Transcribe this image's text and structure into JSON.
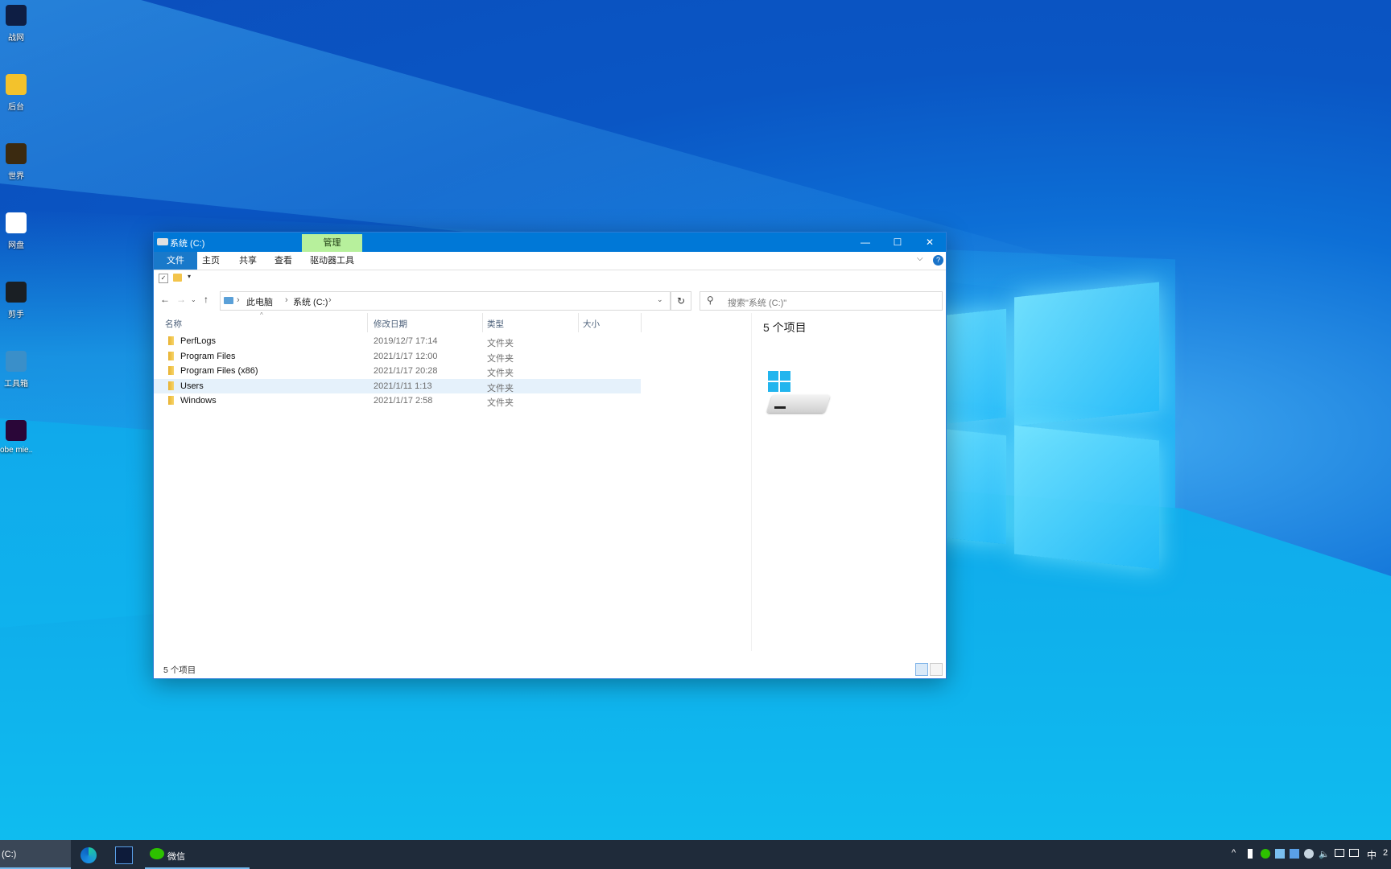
{
  "desktop": {
    "icons": [
      {
        "label": "战网",
        "color": "#0e1e44"
      },
      {
        "label": "后台",
        "color": "#f3c22c"
      },
      {
        "label": "世界",
        "color": "#3b2a10"
      },
      {
        "label": "网盘",
        "color": "#ffffff"
      },
      {
        "label": "剪手",
        "color": "#1a1f24"
      },
      {
        "label": "工具箱",
        "color": "#3a8fc9"
      },
      {
        "label": "obe\nmie...",
        "color": "#2a0638"
      }
    ]
  },
  "window": {
    "title": "系统 (C:)",
    "manage_tab": "管理",
    "controls": {
      "minimize": "—",
      "maximize": "☐",
      "close": "✕"
    }
  },
  "ribbon": {
    "tabs": [
      "文件",
      "主页",
      "共享",
      "查看",
      "驱动器工具"
    ],
    "expand": "⌵",
    "help": "?"
  },
  "qat": {
    "check": "✓",
    "dropdown": "▾"
  },
  "nav": {
    "back": "←",
    "forward": "→",
    "recent": "⌄",
    "up": "↑",
    "breadcrumb": [
      "此电脑",
      "系统 (C:)"
    ],
    "separator": "›",
    "dropdown": "⌄",
    "refresh": "↻"
  },
  "search": {
    "icon": "⚲",
    "placeholder": "搜索\"系统 (C:)\""
  },
  "columns": {
    "name": "名称",
    "date": "修改日期",
    "type": "类型",
    "size": "大小",
    "sort_caret": "^"
  },
  "files": [
    {
      "name": "PerfLogs",
      "date": "2019/12/7 17:14",
      "type": "文件夹"
    },
    {
      "name": "Program Files",
      "date": "2021/1/17 12:00",
      "type": "文件夹"
    },
    {
      "name": "Program Files (x86)",
      "date": "2021/1/17 20:28",
      "type": "文件夹"
    },
    {
      "name": "Users",
      "date": "2021/1/11 1:13",
      "type": "文件夹"
    },
    {
      "name": "Windows",
      "date": "2021/1/17 2:58",
      "type": "文件夹"
    }
  ],
  "hovered_row": 3,
  "detail": {
    "count": "5 个项目"
  },
  "status": {
    "text": "5 个项目"
  },
  "taskbar": {
    "explorer_label": "(C:)",
    "wechat_label": "微信",
    "tray_up": "^",
    "volume": "🔈",
    "ime": "中",
    "clock": "2"
  },
  "colors": {
    "titlebar": "#0078d7",
    "manage_tab": "#b7f09c",
    "accent": "#1979ca"
  }
}
